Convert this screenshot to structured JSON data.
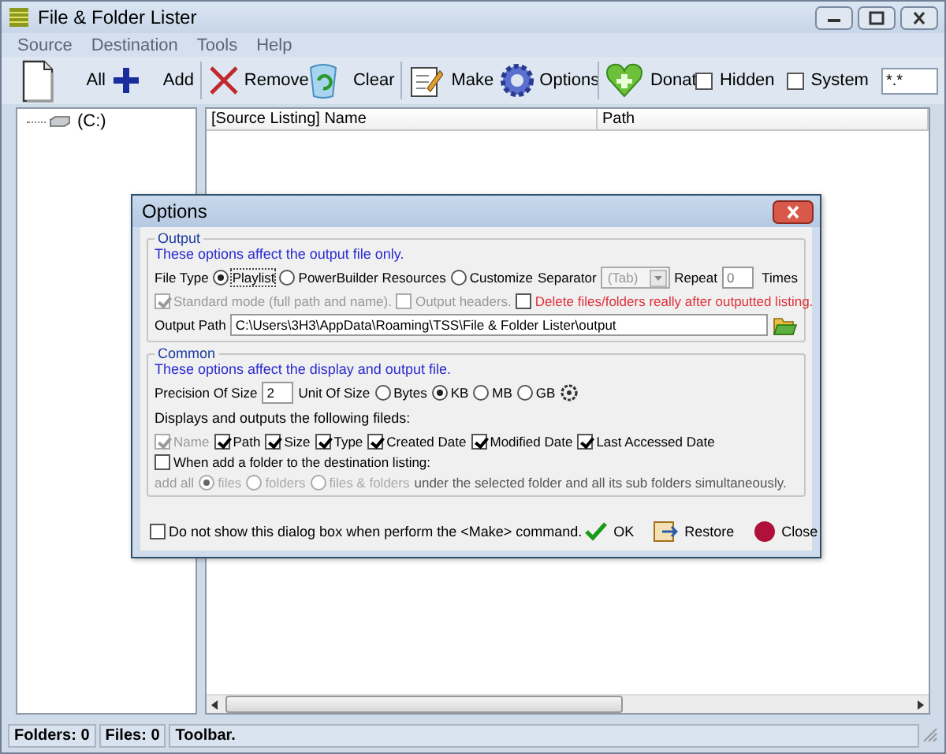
{
  "window": {
    "title": "File & Folder Lister"
  },
  "menu": [
    {
      "label": "Source"
    },
    {
      "label": "Destination"
    },
    {
      "label": "Tools"
    },
    {
      "label": "Help"
    }
  ],
  "toolbar": {
    "buttons": [
      {
        "label": "All",
        "kind": "page"
      },
      {
        "label": "Add",
        "kind": "plus"
      },
      {
        "label": "Remove",
        "kind": "cross"
      },
      {
        "label": "Clear",
        "kind": "bin"
      },
      {
        "label": "Make",
        "kind": "notepad"
      },
      {
        "label": "Options",
        "kind": "gear"
      },
      {
        "label": "Donat",
        "kind": "heart"
      }
    ],
    "checkboxes": [
      {
        "label": "Hidden",
        "checked": false
      },
      {
        "label": "System",
        "checked": false
      }
    ],
    "filter": {
      "value": "*.*"
    }
  },
  "tree": {
    "items": [
      {
        "label": "(C:)"
      }
    ]
  },
  "list": {
    "columns": [
      "[Source Listing] Name",
      "Path"
    ]
  },
  "status_bar": [
    "Folders: 0",
    "Files: 0",
    "Toolbar."
  ],
  "dialog": {
    "title": "Options",
    "output": {
      "title": "Output",
      "note": "These options affect the output file only.",
      "file_type_label": "File Type",
      "file_types": [
        {
          "label": "Playlist",
          "selected": true
        },
        {
          "label": "PowerBuilder Resources",
          "selected": false
        },
        {
          "label": "Customize",
          "selected": false
        }
      ],
      "separator_label": "Separator",
      "separator": {
        "value": "(Tab)",
        "disabled": true
      },
      "repeat_label": "Repeat",
      "repeat": {
        "value": "0",
        "disabled": true
      },
      "times_label": "Times",
      "options": [
        {
          "label": "Standard mode (full path and name).",
          "checked": true,
          "disabled": true,
          "warning": false
        },
        {
          "label": "Output headers.",
          "checked": false,
          "disabled": true,
          "warning": false
        },
        {
          "label": "Delete files/folders really after outputted listing.",
          "checked": false,
          "disabled": false,
          "warning": true
        }
      ],
      "path_label": "Output Path",
      "path": "C:\\Users\\3H3\\AppData\\Roaming\\TSS\\File & Folder Lister\\output"
    },
    "common": {
      "title": "Common",
      "note": "These options affect the display and output file.",
      "precision_label": "Precision Of Size",
      "precision": "2",
      "unit_label": "Unit Of Size",
      "units": [
        {
          "label": "Bytes",
          "selected": false
        },
        {
          "label": "KB",
          "selected": true
        },
        {
          "label": "MB",
          "selected": false
        },
        {
          "label": "GB",
          "selected": false
        }
      ],
      "fields_label": "Displays and outputs the following fileds:",
      "fields": [
        {
          "label": "Name",
          "checked": true,
          "disabled": true
        },
        {
          "label": "Path",
          "checked": true,
          "disabled": false
        },
        {
          "label": "Size",
          "checked": true,
          "disabled": false
        },
        {
          "label": "Type",
          "checked": true,
          "disabled": false
        },
        {
          "label": "Created Date",
          "checked": true,
          "disabled": false
        },
        {
          "label": "Modified Date",
          "checked": true,
          "disabled": false
        },
        {
          "label": "Last Accessed Date",
          "checked": true,
          "disabled": false
        }
      ],
      "folder_option": {
        "label": "When add a folder to the destination listing:",
        "checked": false
      },
      "add_all_label": "add all",
      "add_modes": [
        {
          "label": "files",
          "selected": true,
          "disabled": true
        },
        {
          "label": "folders",
          "selected": false,
          "disabled": true
        },
        {
          "label": "files & folders",
          "selected": false,
          "disabled": true
        }
      ],
      "add_all_suffix": "under the selected folder and all its sub folders simultaneously."
    },
    "footer": {
      "dont_show": {
        "label": "Do not show this dialog box when perform the <Make> command.",
        "checked": false
      },
      "buttons": [
        {
          "label": "OK",
          "kind": "ok"
        },
        {
          "label": "Restore",
          "kind": "restore"
        },
        {
          "label": "Close",
          "kind": "close"
        }
      ]
    }
  }
}
